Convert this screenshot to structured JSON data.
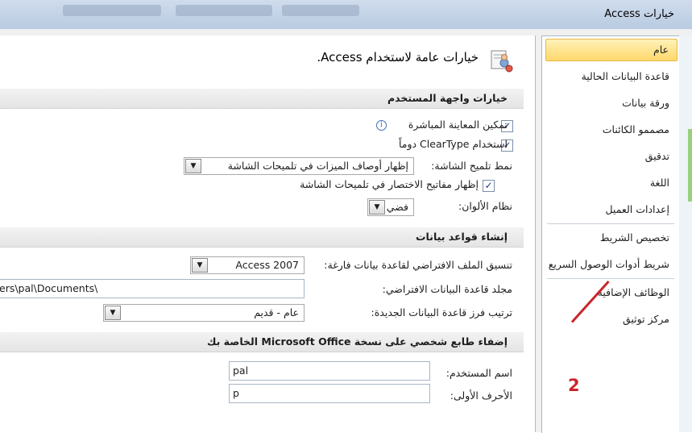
{
  "window": {
    "title": "خيارات Access",
    "background_titles": [
      "Microsoft Access",
      "Access 2007",
      "قاعدة بيانات",
      "Agent"
    ]
  },
  "nav": {
    "items": [
      {
        "label": "عام",
        "selected": true
      },
      {
        "label": "قاعدة البيانات الحالية"
      },
      {
        "label": "ورقة بيانات"
      },
      {
        "label": "مصممو الكائنات"
      },
      {
        "label": "تدقيق"
      },
      {
        "label": "اللغة"
      },
      {
        "label": "إعدادات العميل"
      },
      {
        "label": "تخصيص الشريط"
      },
      {
        "label": "شريط أدوات الوصول السريع"
      },
      {
        "label": "الوظائف الإضافية"
      },
      {
        "label": "مركز توثيق"
      }
    ]
  },
  "header": {
    "title": "خيارات عامة لاستخدام Access."
  },
  "ui_options": {
    "section_title": "خيارات واجهة المستخدم",
    "live_preview_label": "تمكين المعاينة المباشرة",
    "live_preview_checked": true,
    "cleartype_label": "استخدام ClearType دوماً",
    "cleartype_checked": true,
    "screentip_style_label": "نمط تلميح الشاشة:",
    "screentip_style_value": "إظهار أوصاف الميزات في تلميحات الشاشة",
    "shortcut_keys_label": "إظهار مفاتيح الاختصار في تلميحات الشاشة",
    "shortcut_keys_checked": true,
    "color_scheme_label": "نظام الألوان:",
    "color_scheme_value": "فضي"
  },
  "create_db": {
    "section_title": "إنشاء قواعد بيانات",
    "file_format_label": "تنسيق الملف الافتراضي لقاعدة بيانات فارغة:",
    "file_format_value": "Access 2007",
    "db_folder_label": "مجلد قاعدة البيانات الافتراضي:",
    "db_folder_value": "ers\\pal\\Documents\\",
    "sort_order_label": "ترتيب فرز قاعدة البيانات الجديدة:",
    "sort_order_value": "عام - قديم"
  },
  "personalize": {
    "section_title": "إضفاء طابع شخصي على نسخة Microsoft Office الخاصة بك",
    "username_label": "اسم المستخدم:",
    "username_value": "pal",
    "initials_label": "الأحرف الأولى:",
    "initials_value": "p"
  },
  "annotation": {
    "number": "2",
    "color": "#c8262b"
  },
  "colors": {
    "selected_nav_bg": "#ffd86a",
    "section_bar_bg": "#e8e8e8",
    "titlebar_bg": "#c3d3e8"
  }
}
